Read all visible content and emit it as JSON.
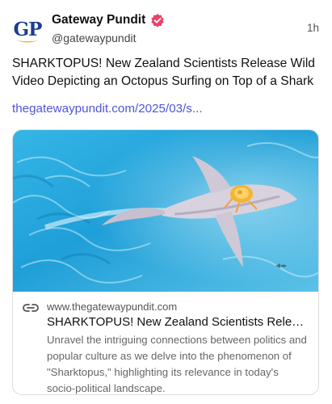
{
  "post": {
    "author": {
      "avatar_text": "GP",
      "display_name": "Gateway Pundit",
      "handle": "@gatewaypundit",
      "verified_badge_icon": "verified-badge-icon"
    },
    "timestamp": "1h",
    "text": "SHARKTOPUS! New Zealand Scientists Release Wild Video Depicting an Octopus Surfing on Top of a Shark",
    "link_text": "thegatewaypundit.com/2025/03/s...",
    "link_card": {
      "image_icon": "shark-octopus-photo",
      "domain_icon": "link-icon",
      "domain": "www.thegatewaypundit.com",
      "title": "SHARKTOPUS! New Zealand Scientists Release Wild Video Depicting an Octopus Surfing on Top of a Shark",
      "description": "Unravel the intriguing connections between politics and popular culture as we delve into the phenomenon of \"Sharktopus,\" highlighting its relevance in today's socio-political landscape."
    }
  },
  "colors": {
    "link": "#4f56d6",
    "badge": "#e8436b",
    "avatar_blue": "#1b3e8f",
    "avatar_orange": "#f2a23a",
    "water": "#1f9fd8"
  }
}
